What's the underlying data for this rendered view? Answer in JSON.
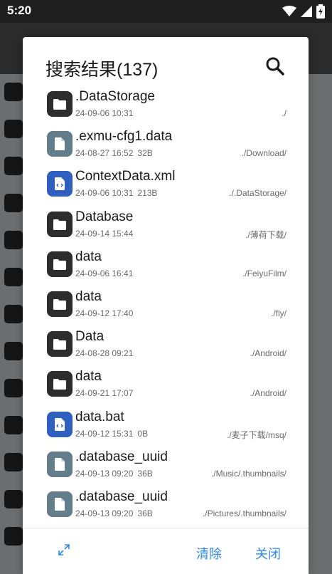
{
  "status_bar": {
    "time": "5:20"
  },
  "dialog": {
    "title": "搜索结果(137)",
    "results": [
      {
        "name": ".DataStorage",
        "date": "24-09-06 10:31",
        "size": "",
        "path": "./",
        "type": "folder"
      },
      {
        "name": ".exmu-cfg1.data",
        "date": "24-08-27 16:52",
        "size": "32B",
        "path": "./Download/",
        "type": "file"
      },
      {
        "name": "ContextData.xml",
        "date": "24-09-06 10:31",
        "size": "213B",
        "path": "./.DataStorage/",
        "type": "code"
      },
      {
        "name": "Database",
        "date": "24-09-14 15:44",
        "size": "",
        "path": "./薄荷下载/",
        "type": "folder"
      },
      {
        "name": "data",
        "date": "24-09-06 16:41",
        "size": "",
        "path": "./FeiyuFilm/",
        "type": "folder"
      },
      {
        "name": "data",
        "date": "24-09-12 17:40",
        "size": "",
        "path": "./fly/",
        "type": "folder"
      },
      {
        "name": "Data",
        "date": "24-08-28 09:21",
        "size": "",
        "path": "./Android/",
        "type": "folder"
      },
      {
        "name": "data",
        "date": "24-09-21 17:07",
        "size": "",
        "path": "./Android/",
        "type": "folder"
      },
      {
        "name": "data.bat",
        "date": "24-09-12 15:31",
        "size": "0B",
        "path": "./麦子下载/msq/",
        "type": "code"
      },
      {
        "name": ".database_uuid",
        "date": "24-09-13 09:20",
        "size": "36B",
        "path": "./Music/.thumbnails/",
        "type": "file"
      },
      {
        "name": ".database_uuid",
        "date": "24-09-13 09:20",
        "size": "36B",
        "path": "./Pictures/.thumbnails/",
        "type": "file"
      }
    ],
    "clear_label": "清除",
    "close_label": "关闭"
  },
  "colors": {
    "folder_icon": "#2d2d2d",
    "file_icon": "#647d8b",
    "code_icon": "#2f5fbf",
    "accent": "#2f88e8"
  },
  "icons": {
    "search": "search-icon",
    "expand": "expand-icon",
    "folder": "folder-icon",
    "file": "file-icon",
    "code": "code-file-icon"
  }
}
